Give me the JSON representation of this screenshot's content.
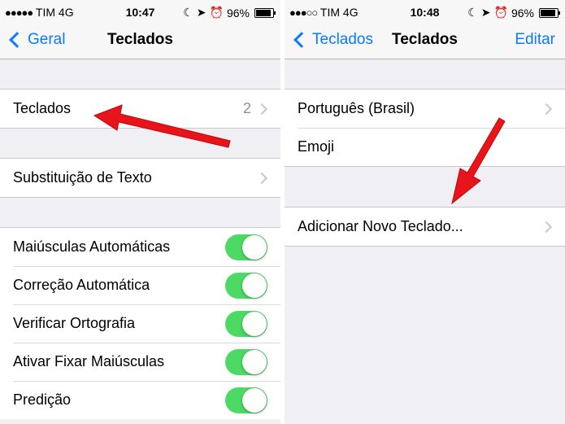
{
  "colors": {
    "accent": "#0a7aff",
    "toggle_on": "#4cd964",
    "arrow": "#e8141a"
  },
  "left": {
    "status": {
      "dots": "●●●●●",
      "carrier": "TIM",
      "network": "4G",
      "time": "10:47",
      "battery_text": "96%",
      "icons": [
        "moon-icon",
        "location-icon",
        "alarm-icon",
        "battery-icon"
      ]
    },
    "nav": {
      "back_label": "Geral",
      "title": "Teclados"
    },
    "groups": [
      {
        "cells": [
          {
            "label": "Teclados",
            "detail": "2"
          }
        ]
      },
      {
        "cells": [
          {
            "label": "Substituição de Texto"
          }
        ]
      },
      {
        "cells": [
          {
            "label": "Maiúsculas Automáticas",
            "on": true
          },
          {
            "label": "Correção Automática",
            "on": true
          },
          {
            "label": "Verificar Ortografia",
            "on": true
          },
          {
            "label": "Ativar Fixar Maiúsculas",
            "on": true
          },
          {
            "label": "Predição",
            "on": true
          }
        ]
      }
    ]
  },
  "right": {
    "status": {
      "dots": "●●●○○",
      "carrier": "TIM",
      "network": "4G",
      "time": "10:48",
      "battery_text": "96%",
      "icons": [
        "moon-icon",
        "location-icon",
        "alarm-icon",
        "battery-icon"
      ]
    },
    "nav": {
      "back_label": "Teclados",
      "title": "Teclados",
      "right_label": "Editar"
    },
    "groups": [
      {
        "cells": [
          {
            "label": "Português (Brasil)"
          },
          {
            "label": "Emoji"
          }
        ]
      },
      {
        "cells": [
          {
            "label": "Adicionar Novo Teclado..."
          }
        ]
      }
    ]
  }
}
